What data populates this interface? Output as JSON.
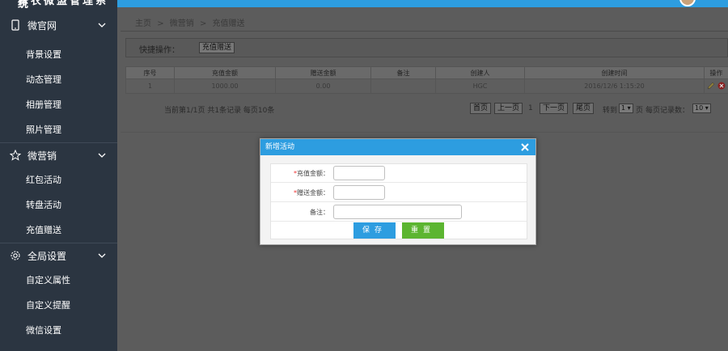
{
  "sidebar": {
    "app_title": "青农微盟管理系统",
    "groups": [
      {
        "label": "微官网",
        "icon": "mobile-icon",
        "items": [
          "背景设置",
          "动态管理",
          "相册管理",
          "照片管理"
        ]
      },
      {
        "label": "微营销",
        "icon": "star-icon",
        "items": [
          "红包活动",
          "转盘活动",
          "充值赠送"
        ]
      },
      {
        "label": "全局设置",
        "icon": "gear-icon",
        "items": [
          "自定义属性",
          "自定义提醒",
          "微信设置"
        ]
      }
    ]
  },
  "breadcrumb": {
    "home": "主页",
    "sep": ">",
    "section": "微营销",
    "page": "充值赠送"
  },
  "quickbar": {
    "label": "快捷操作：",
    "button": "充值赠送"
  },
  "table": {
    "headers": [
      "序号",
      "充值金额",
      "赠送金额",
      "备注",
      "创建人",
      "创建时间",
      "操作"
    ],
    "rows": [
      {
        "no": "1",
        "recharge": "1000.00",
        "gift": "0.00",
        "note": "",
        "creator": "HGC",
        "created": "2016/12/6 1:15:20"
      }
    ]
  },
  "pager": {
    "info": "当前第1/1页  共1条记录  每页10条",
    "first": "首页",
    "prev": "上一页",
    "current": "1",
    "next": "下一页",
    "last": "尾页",
    "goto_label": "转到",
    "goto_value": "1",
    "page_suffix": "页",
    "per_page_label": "每页记录数：",
    "per_page_value": "10"
  },
  "modal": {
    "title": "新增活动",
    "fields": [
      {
        "label": "充值金额：",
        "required": true,
        "value": ""
      },
      {
        "label": "赠送金额：",
        "required": true,
        "value": ""
      },
      {
        "label": "备注：",
        "required": false,
        "value": ""
      }
    ],
    "save": "保存",
    "reset": "重置"
  },
  "colors": {
    "accent": "#2d9de0",
    "sidebar": "#2b3541",
    "reset_green": "#5cb531",
    "required": "#e33333"
  }
}
